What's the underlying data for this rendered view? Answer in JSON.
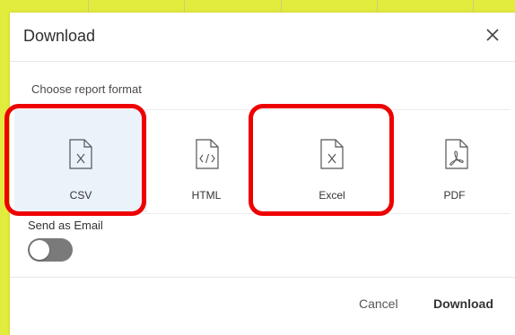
{
  "dialog": {
    "title": "Download",
    "close_icon": "close-icon",
    "section_label": "Choose report format",
    "formats": [
      {
        "label": "CSV",
        "icon": "excel-file-icon",
        "selected": true
      },
      {
        "label": "HTML",
        "icon": "code-file-icon",
        "selected": false
      },
      {
        "label": "Excel",
        "icon": "excel-file-icon",
        "selected": false
      },
      {
        "label": "PDF",
        "icon": "pdf-file-icon",
        "selected": false
      }
    ],
    "email": {
      "label": "Send as Email",
      "enabled": false
    },
    "footer": {
      "cancel_label": "Cancel",
      "download_label": "Download"
    }
  },
  "colors": {
    "selected_tile": "#eaf2fa",
    "toggle_off": "#7a7a7a",
    "annotation_red": "#ee0000",
    "app_frame_yellow": "#e2ec3c"
  }
}
